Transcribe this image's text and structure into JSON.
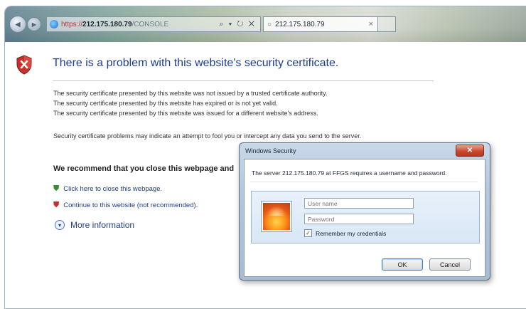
{
  "browser": {
    "back_glyph": "◀",
    "forward_glyph": "▶",
    "address": {
      "protocol": "https://",
      "host": "212.175.180.79",
      "path": "/CONSOLE",
      "tools": "⌕ ▾ ↻ ✕"
    },
    "tab": {
      "label": "212.175.180.79",
      "close": "×"
    }
  },
  "page": {
    "title": "There is a problem with this website's security certificate.",
    "messages": [
      "The security certificate presented by this website was not issued by a trusted certificate authority.",
      "The security certificate presented by this website has expired or is not yet valid.",
      "The security certificate presented by this website was issued for a different website's address."
    ],
    "warning": "Security certificate problems may indicate an attempt to fool you or intercept any data you send to the server.",
    "recommend": "We recommend that you close this webpage and",
    "close_link": "Click here to close this webpage.",
    "continue_link": "Continue to this website (not recommended).",
    "more_info": "More information",
    "colors": {
      "title": "#1f3d8a",
      "shield": "#c8302c",
      "link": "#1f3d8a"
    }
  },
  "dialog": {
    "title": "Windows Security",
    "close_glyph": "✕",
    "message": "The server 212.175.180.79 at FFGS requires a username and password.",
    "username_placeholder": "User name",
    "password_placeholder": "Password",
    "remember_checked": true,
    "remember_label": "Remember my credentials",
    "ok_label": "OK",
    "cancel_label": "Cancel"
  }
}
